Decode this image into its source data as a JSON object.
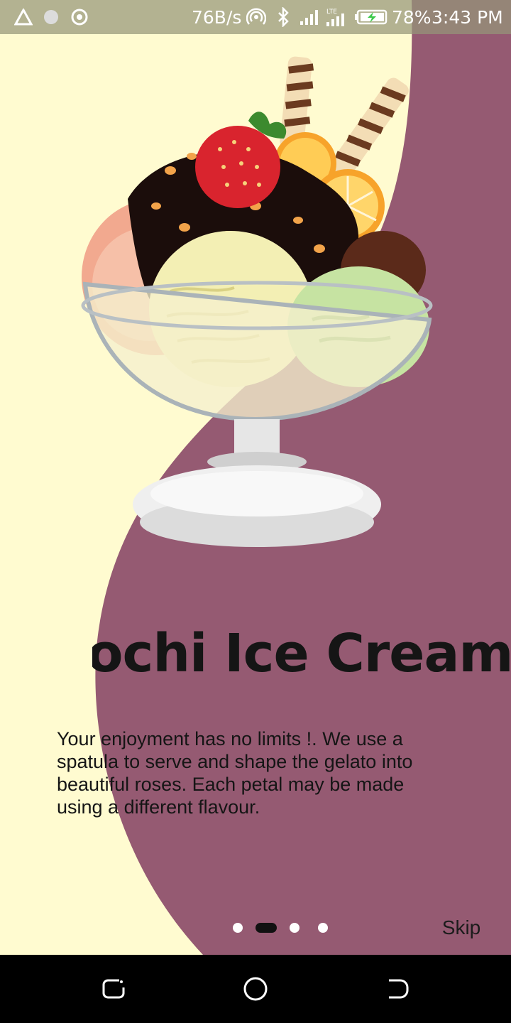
{
  "status_bar": {
    "net_speed": "76B/s",
    "network_type": "LTE",
    "battery": "78%",
    "time": "3:43 PM",
    "icons": [
      "warning-triangle-icon",
      "dot-icon",
      "target-icon",
      "hotspot-icon",
      "bluetooth-icon",
      "signal-icon",
      "lte-signal-icon",
      "battery-charging-icon"
    ]
  },
  "onboarding": {
    "title": "Mochi Ice Cream",
    "description": "Your enjoyment has no limits !. We use a spatula to serve and shape the gelato into beautiful roses. Each petal may be made using a different flavour.",
    "skip_label": "Skip",
    "page_count": 4,
    "current_page": 2,
    "illustration": "ice-cream-sundae"
  },
  "colors": {
    "cream_background": "#fffbd0",
    "accent_plum": "#955a72",
    "text": "#151515"
  },
  "nav_bar": {
    "buttons": [
      "recent-apps",
      "home",
      "back"
    ]
  }
}
